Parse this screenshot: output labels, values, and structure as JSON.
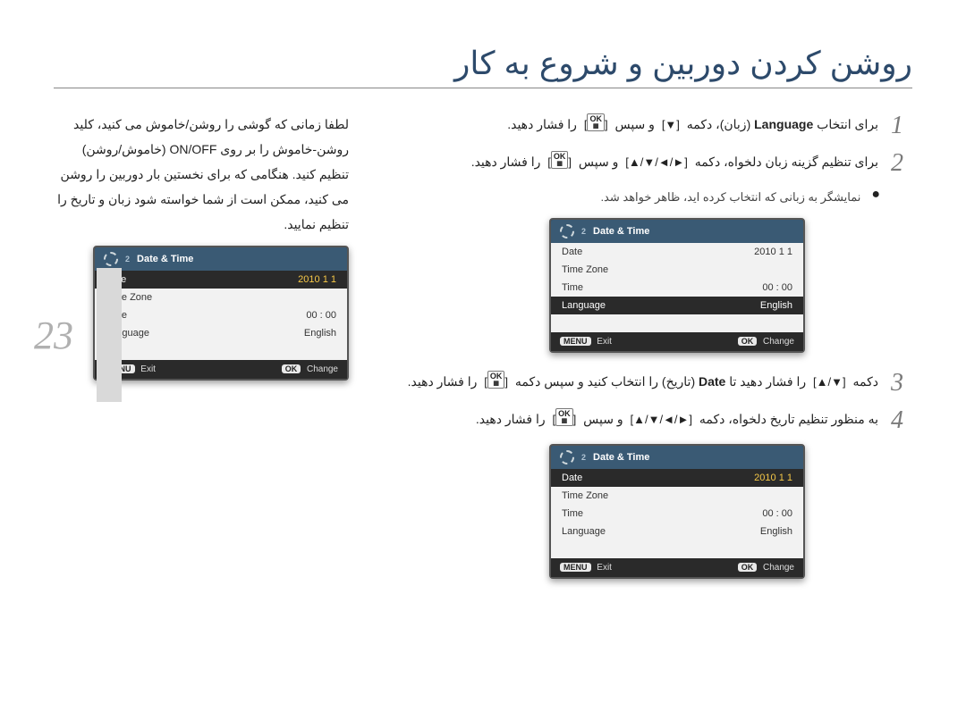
{
  "title": "روشن کردن دوربین و شروع به کار",
  "page_number": "23",
  "right_column": {
    "para1": "لطفا زمانی که گوشی را روشن/خاموش می کنید، کلید روشن-خاموش را بر روی ON/OFF (خاموش/روشن) تنظیم کنید. هنگامی که برای نخستین بار دوربین را روشن می کنید، ممکن است از شما خواسته شود زبان و تاریخ را تنظیم نمایید."
  },
  "steps": {
    "s1": {
      "num": "1",
      "text_a": "برای انتخاب ",
      "lang_word": "Language",
      "text_b": " (زبان)، دکمه ",
      "key1": "[▼]",
      "text_c": " و سپس ",
      "ok": "OK",
      "text_d": " را فشار دهید."
    },
    "s2": {
      "num": "2",
      "text_a": "برای تنظیم گزینه زبان دلخواه، دکمه ",
      "key1": "[▲/▼/◄/►]",
      "text_b": " و سپس ",
      "ok": "OK",
      "text_c": " را فشار دهید."
    },
    "bullet": "نمایشگر به زبانی که انتخاب کرده اید، ظاهر خواهد شد.",
    "s3": {
      "num": "3",
      "text_a": "دکمه ",
      "key1": "[▲/▼]",
      "text_b": " را فشار دهید تا ",
      "date_word": "Date",
      "text_c": " (تاریخ) را انتخاب کنید و سپس دکمه ",
      "ok": "OK",
      "text_d": " را فشار دهید."
    },
    "s4": {
      "num": "4",
      "text_a": "به منظور تنظیم تاریخ دلخواه، دکمه ",
      "key1": "[▲/▼/◄/►]",
      "text_b": " و سپس ",
      "ok": "OK",
      "text_c": " را فشار دهید."
    }
  },
  "cam": {
    "header": "Date & Time",
    "rows": {
      "date_label": "Date",
      "date_value": "2010   1   1",
      "tz_label": "Time Zone",
      "time_label": "Time",
      "time_value": "00 : 00",
      "lang_label": "Language",
      "lang_value": "English"
    },
    "footer": {
      "menu_pill": "MENU",
      "exit": "Exit",
      "ok_pill": "OK",
      "change": "Change"
    }
  },
  "chart_data": null
}
